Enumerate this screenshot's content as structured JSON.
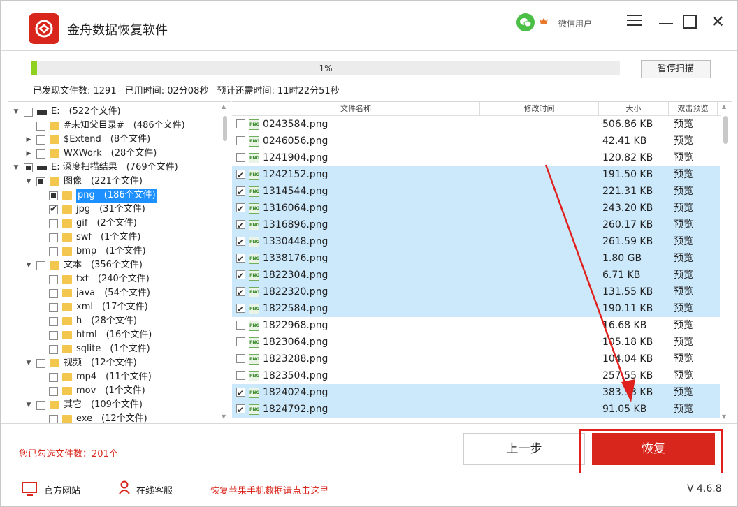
{
  "app": {
    "title": "金舟数据恢复软件",
    "user": "微信用户"
  },
  "scan": {
    "progress_text": "1%",
    "progress_fraction": 0.01,
    "pause_label": "暂停扫描",
    "found": "已发现文件数: 1291",
    "elapsed": "已用时间: 02分08秒",
    "remaining": "预计还需时间: 11时22分51秒"
  },
  "tree": [
    {
      "level": 0,
      "arrow": "▼",
      "state": "none",
      "icon": "drive-icon",
      "label": "E:　(522个文件)"
    },
    {
      "level": 1,
      "arrow": "",
      "state": "none",
      "icon": "folder-icon",
      "label": "#未知父目录#　(486个文件)"
    },
    {
      "level": 1,
      "arrow": "▶",
      "state": "none",
      "icon": "folder-icon",
      "label": "$Extend　(8个文件)"
    },
    {
      "level": 1,
      "arrow": "▶",
      "state": "none",
      "icon": "folder-icon",
      "label": "WXWork　(28个文件)"
    },
    {
      "level": 0,
      "arrow": "▼",
      "state": "partial",
      "icon": "drive-icon",
      "label": "E: 深度扫描结果　(769个文件)"
    },
    {
      "level": 1,
      "arrow": "▼",
      "state": "partial",
      "icon": "folder-icon",
      "label": "图像　(221个文件)"
    },
    {
      "level": 2,
      "arrow": "",
      "state": "partial",
      "icon": "folder-icon",
      "label": "png　(186个文件)",
      "selected": true
    },
    {
      "level": 2,
      "arrow": "",
      "state": "checked",
      "icon": "folder-icon",
      "label": "jpg　(31个文件)"
    },
    {
      "level": 2,
      "arrow": "",
      "state": "none",
      "icon": "folder-icon",
      "label": "gif　(2个文件)"
    },
    {
      "level": 2,
      "arrow": "",
      "state": "none",
      "icon": "folder-icon",
      "label": "swf　(1个文件)"
    },
    {
      "level": 2,
      "arrow": "",
      "state": "none",
      "icon": "folder-icon",
      "label": "bmp　(1个文件)"
    },
    {
      "level": 1,
      "arrow": "▼",
      "state": "none",
      "icon": "folder-icon",
      "label": "文本　(356个文件)"
    },
    {
      "level": 2,
      "arrow": "",
      "state": "none",
      "icon": "folder-icon",
      "label": "txt　(240个文件)"
    },
    {
      "level": 2,
      "arrow": "",
      "state": "none",
      "icon": "folder-icon",
      "label": "java　(54个文件)"
    },
    {
      "level": 2,
      "arrow": "",
      "state": "none",
      "icon": "folder-icon",
      "label": "xml　(17个文件)"
    },
    {
      "level": 2,
      "arrow": "",
      "state": "none",
      "icon": "folder-icon",
      "label": "h　(28个文件)"
    },
    {
      "level": 2,
      "arrow": "",
      "state": "none",
      "icon": "folder-icon",
      "label": "html　(16个文件)"
    },
    {
      "level": 2,
      "arrow": "",
      "state": "none",
      "icon": "folder-icon",
      "label": "sqlite　(1个文件)"
    },
    {
      "level": 1,
      "arrow": "▼",
      "state": "none",
      "icon": "folder-icon",
      "label": "视频　(12个文件)"
    },
    {
      "level": 2,
      "arrow": "",
      "state": "none",
      "icon": "folder-icon",
      "label": "mp4　(11个文件)"
    },
    {
      "level": 2,
      "arrow": "",
      "state": "none",
      "icon": "folder-icon",
      "label": "mov　(1个文件)"
    },
    {
      "level": 1,
      "arrow": "▼",
      "state": "none",
      "icon": "folder-icon",
      "label": "其它　(109个文件)"
    },
    {
      "level": 2,
      "arrow": "",
      "state": "none",
      "icon": "folder-icon",
      "label": "exe　(12个文件)"
    }
  ],
  "file_columns": {
    "name": "文件名称",
    "modified": "修改时间",
    "size": "大小",
    "preview": "双击预览"
  },
  "files": [
    {
      "checked": false,
      "name": "0243584.png",
      "size": "506.86 KB",
      "preview": "预览"
    },
    {
      "checked": false,
      "name": "0246056.png",
      "size": "42.41 KB",
      "preview": "预览"
    },
    {
      "checked": false,
      "name": "1241904.png",
      "size": "120.82 KB",
      "preview": "预览"
    },
    {
      "checked": true,
      "name": "1242152.png",
      "size": "191.50 KB",
      "preview": "预览"
    },
    {
      "checked": true,
      "name": "1314544.png",
      "size": "221.31 KB",
      "preview": "预览"
    },
    {
      "checked": true,
      "name": "1316064.png",
      "size": "243.20 KB",
      "preview": "预览"
    },
    {
      "checked": true,
      "name": "1316896.png",
      "size": "260.17 KB",
      "preview": "预览"
    },
    {
      "checked": true,
      "name": "1330448.png",
      "size": "261.59 KB",
      "preview": "预览"
    },
    {
      "checked": true,
      "name": "1338176.png",
      "size": "1.80 GB",
      "preview": "预览"
    },
    {
      "checked": true,
      "name": "1822304.png",
      "size": "6.71 KB",
      "preview": "预览"
    },
    {
      "checked": true,
      "name": "1822320.png",
      "size": "131.55 KB",
      "preview": "预览"
    },
    {
      "checked": true,
      "name": "1822584.png",
      "size": "190.11 KB",
      "preview": "预览"
    },
    {
      "checked": false,
      "name": "1822968.png",
      "size": "16.68 KB",
      "preview": "预览"
    },
    {
      "checked": false,
      "name": "1823064.png",
      "size": "105.18 KB",
      "preview": "预览"
    },
    {
      "checked": false,
      "name": "1823288.png",
      "size": "104.04 KB",
      "preview": "预览"
    },
    {
      "checked": false,
      "name": "1823504.png",
      "size": "257.55 KB",
      "preview": "预览"
    },
    {
      "checked": true,
      "name": "1824024.png",
      "size": "383.53 KB",
      "preview": "预览"
    },
    {
      "checked": true,
      "name": "1824792.png",
      "size": "91.05 KB",
      "preview": "预览"
    }
  ],
  "actions": {
    "selected_count": "您已勾选文件数：201个",
    "back_label": "上一步",
    "recover_label": "恢复"
  },
  "footer": {
    "site": "官方网站",
    "service": "在线客服",
    "apple": "恢复苹果手机数据请点击这里",
    "version": "V 4.6.8"
  },
  "colors": {
    "brand": "#d9261c",
    "progress": "#8fd11f",
    "selection": "#cce8fb",
    "tree_selection": "#1e90ff"
  }
}
